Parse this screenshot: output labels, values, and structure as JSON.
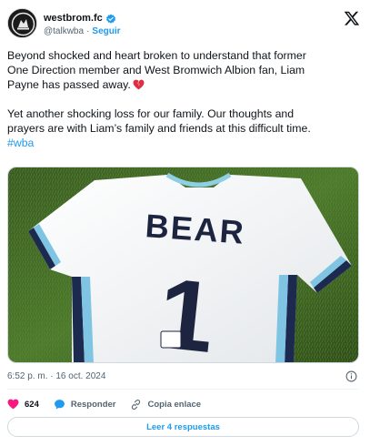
{
  "author": {
    "display_name": "westbrom.fc",
    "handle": "@talkwba",
    "separator": "·",
    "follow_label": "Seguir"
  },
  "tweet": {
    "line1": "Beyond shocked and heart broken to understand that former",
    "line2": "One Direction member and West Bromwich Albion fan, Liam",
    "line3": "Payne has passed away.",
    "line4": "Yet another shocking loss for our family. Our thoughts and",
    "line5": "prayers are with Liam’s family and friends at this difficult time.",
    "hashtag": "#wba"
  },
  "media": {
    "shirt_name": "BEAR",
    "shirt_number": "1"
  },
  "meta": {
    "timestamp": "6:52 p. m. · 16 oct. 2024"
  },
  "actions": {
    "likes": "624",
    "reply_label": "Responder",
    "copy_link_label": "Copia enlace"
  },
  "replies_button": "Leer 4 respuestas",
  "colors": {
    "accent": "#1d9bf0",
    "like": "#f91880",
    "text": "#0f1419",
    "muted": "#536471"
  }
}
